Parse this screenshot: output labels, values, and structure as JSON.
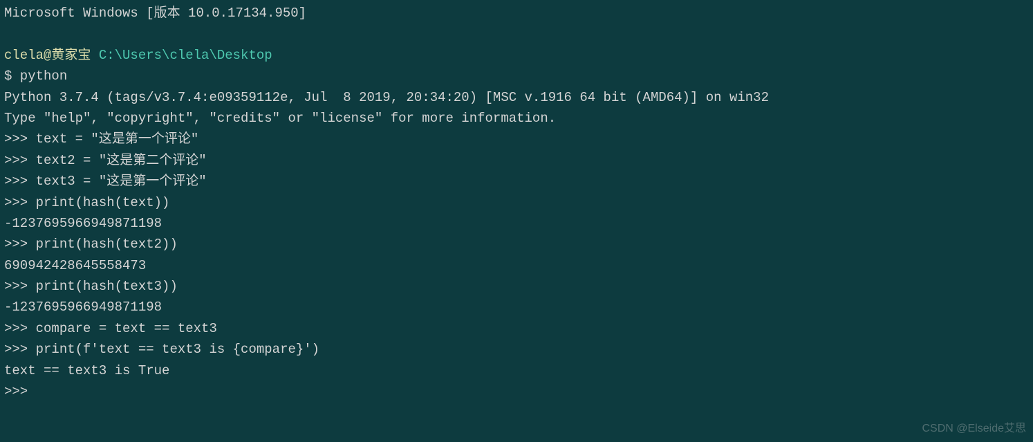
{
  "terminal": {
    "header": "Microsoft Windows [版本 10.0.17134.950]",
    "prompt_user": "clela@黄家宝",
    "prompt_path": " C:\\Users\\clela\\Desktop",
    "shell_prompt": "$ python",
    "python_version": "Python 3.7.4 (tags/v3.7.4:e09359112e, Jul  8 2019, 20:34:20) [MSC v.1916 64 bit (AMD64)] on win32",
    "python_help": "Type \"help\", \"copyright\", \"credits\" or \"license\" for more information.",
    "lines": [
      ">>> text = \"这是第一个评论\"",
      ">>> text2 = \"这是第二个评论\"",
      ">>> text3 = \"这是第一个评论\"",
      ">>> print(hash(text))",
      "-1237695966949871198",
      ">>> print(hash(text2))",
      "690942428645558473",
      ">>> print(hash(text3))",
      "-1237695966949871198",
      ">>> compare = text == text3",
      ">>> print(f'text == text3 is {compare}')",
      "text == text3 is True",
      ">>>"
    ]
  },
  "watermark": "CSDN @Elseide艾思"
}
